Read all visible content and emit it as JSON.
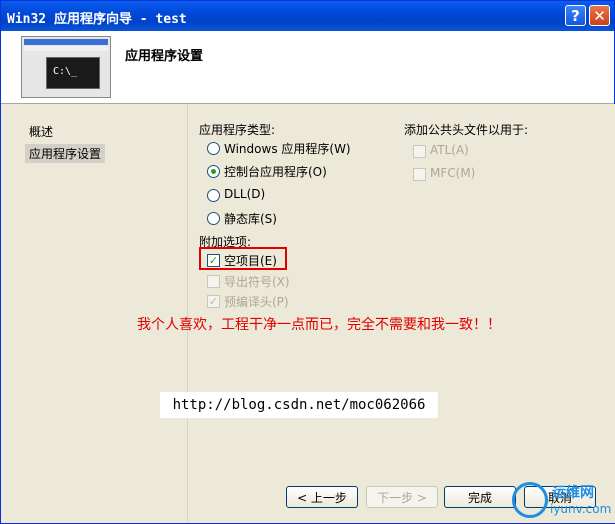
{
  "window": {
    "title": "Win32 应用程序向导 - test",
    "help_label": "?",
    "close_label": "✕"
  },
  "header": {
    "page_title": "应用程序设置",
    "thumb_prompt": "C:\\_"
  },
  "sidebar": {
    "items": [
      {
        "label": "概述"
      },
      {
        "label": "应用程序设置"
      }
    ]
  },
  "app_type": {
    "label": "应用程序类型:",
    "options": [
      {
        "label": "Windows 应用程序(W)",
        "selected": false
      },
      {
        "label": "控制台应用程序(O)",
        "selected": true
      },
      {
        "label": "DLL(D)",
        "selected": false
      },
      {
        "label": "静态库(S)",
        "selected": false
      }
    ]
  },
  "headers": {
    "label": "添加公共头文件以用于:",
    "options": [
      {
        "label": "ATL(A)"
      },
      {
        "label": "MFC(M)"
      }
    ]
  },
  "extra": {
    "label": "附加选项:",
    "options": [
      {
        "label": "空项目(E)",
        "checked": true
      },
      {
        "label": "导出符号(X)",
        "checked": false
      },
      {
        "label": "预编译头(P)",
        "checked": true
      }
    ]
  },
  "annotation": "我个人喜欢，工程干净一点而已，完全不需要和我一致！！",
  "url": "http://blog.csdn.net/moc062066",
  "buttons": {
    "back": "< 上一步",
    "next": "下一步 >",
    "finish": "完成",
    "cancel": "取消"
  },
  "watermark": {
    "text": "运维网",
    "sub": "iyunv.com"
  }
}
